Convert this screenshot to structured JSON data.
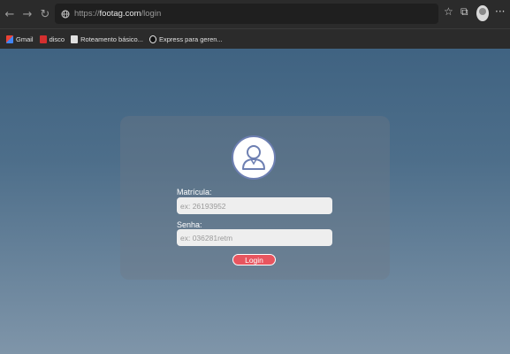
{
  "browser": {
    "url_prefix": "https://",
    "url_domain": "footag.com",
    "url_path": "/login",
    "back_icon": "←",
    "forward_icon": "→",
    "refresh_icon": "↻",
    "favorites_icon": "☆",
    "collections_icon": "⧉",
    "more_icon": "···"
  },
  "bookmarks": [
    {
      "label": "Gmail",
      "color": "#ea4335"
    },
    {
      "label": "disco",
      "color": "#d32f2f"
    },
    {
      "label": "Roteamento básico...",
      "color": "#e0e0e0"
    },
    {
      "label": "Express para geren...",
      "color": "#111111"
    }
  ],
  "login": {
    "matricula_label": "Matrícula:",
    "matricula_placeholder": "ex: 26193952",
    "senha_label": "Senha:",
    "senha_placeholder": "ex: 036281retm",
    "button_label": "Login"
  },
  "colors": {
    "button": "#e8555f",
    "avatar_stroke": "#6d7fb2"
  }
}
